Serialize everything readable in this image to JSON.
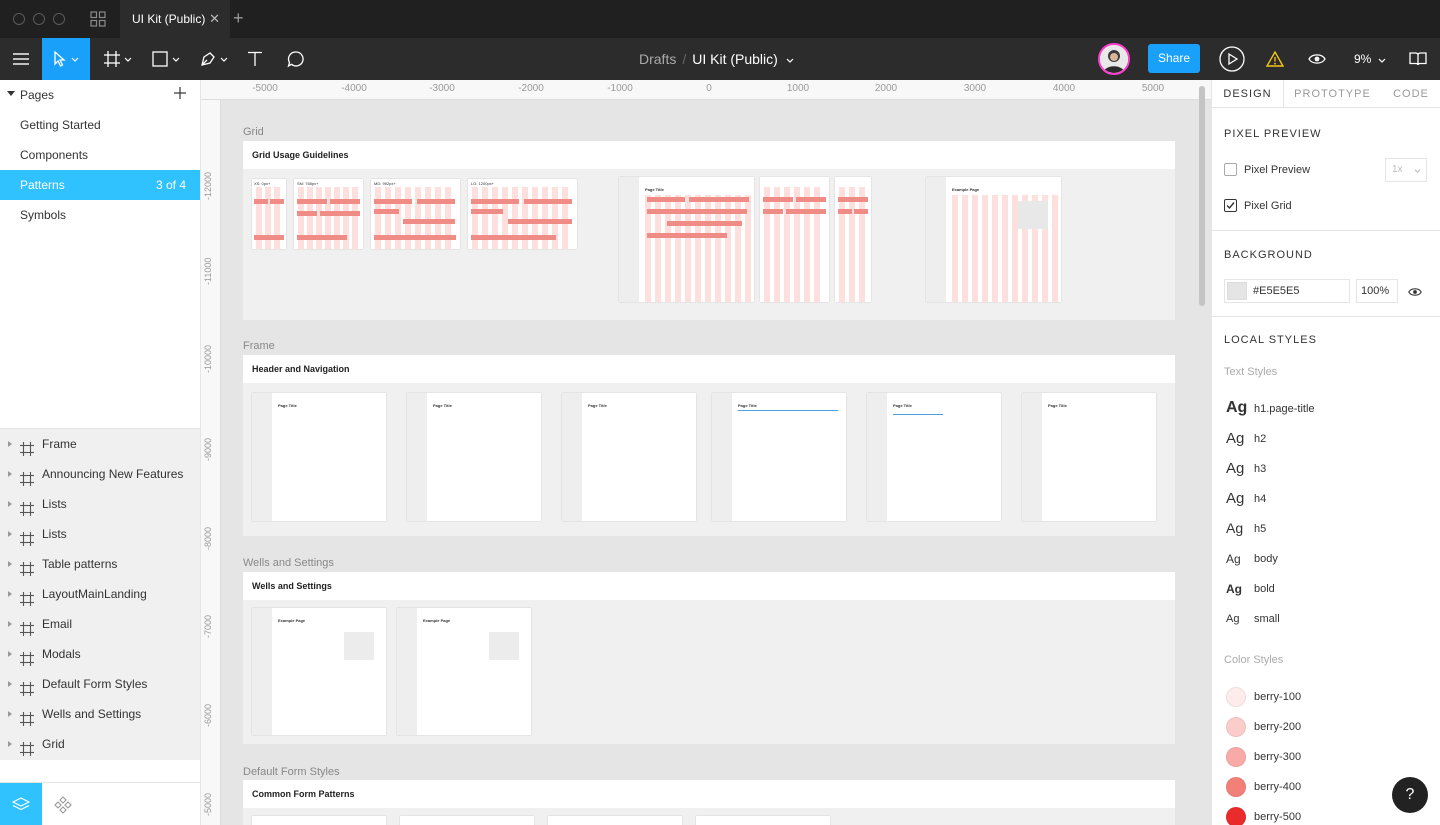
{
  "window": {
    "tab_title": "UI Kit (Public)",
    "tab_close": "✕",
    "tab_add": "+"
  },
  "toolbar": {
    "breadcrumb_parent": "Drafts",
    "breadcrumb_sep": "/",
    "file_name": "UI Kit (Public)",
    "share_label": "Share",
    "zoom_label": "9%"
  },
  "pages": {
    "header": "Pages",
    "items": [
      {
        "label": "Getting Started",
        "count": ""
      },
      {
        "label": "Components",
        "count": ""
      },
      {
        "label": "Patterns",
        "count": "3 of 4"
      },
      {
        "label": "Symbols",
        "count": ""
      }
    ]
  },
  "layers": [
    "Frame",
    "Announcing New Features",
    "Lists",
    "Lists",
    "Table patterns",
    "LayoutMainLanding",
    "Email",
    "Modals",
    "Default Form Styles",
    "Wells and Settings",
    "Grid"
  ],
  "rulers": {
    "top": [
      "-5000",
      "-4000",
      "-3000",
      "-2000",
      "-1000",
      "0",
      "1000",
      "2000",
      "3000",
      "4000",
      "5000"
    ],
    "left": [
      "-12000",
      "-11000",
      "-10000",
      "-9000",
      "-8000",
      "-7000",
      "-6000",
      "-5000"
    ]
  },
  "canvas": {
    "sections": [
      {
        "label": "Grid",
        "bar_title": "Grid Usage Guidelines"
      },
      {
        "label": "Frame",
        "bar_title": "Header and Navigation"
      },
      {
        "label": "Wells and Settings",
        "bar_title": "Wells and Settings"
      },
      {
        "label": "Default Form Styles",
        "bar_title": "Common Form Patterns"
      }
    ],
    "grid_labels": [
      "XS: 0px+",
      "SM: 768px+",
      "MD: 992px+",
      "LG: 1200px+"
    ],
    "page_title": "Page Title",
    "example_page": "Example Page"
  },
  "right": {
    "tabs": [
      "DESIGN",
      "PROTOTYPE",
      "CODE"
    ],
    "pixel_preview_title": "PIXEL PREVIEW",
    "pixel_preview_label": "Pixel Preview",
    "pixel_grid_label": "Pixel Grid",
    "scale_value": "1x",
    "background_title": "BACKGROUND",
    "background_hex": "#E5E5E5",
    "background_opacity": "100%",
    "local_styles_title": "LOCAL STYLES",
    "text_styles_title": "Text Styles",
    "text_styles": [
      {
        "ag": "Ag",
        "name": "h1.page-title"
      },
      {
        "ag": "Ag",
        "name": "h2"
      },
      {
        "ag": "Ag",
        "name": "h3"
      },
      {
        "ag": "Ag",
        "name": "h4"
      },
      {
        "ag": "Ag",
        "name": "h5"
      },
      {
        "ag": "Ag",
        "name": "body"
      },
      {
        "ag": "Ag",
        "name": "bold"
      },
      {
        "ag": "Ag",
        "name": "small"
      }
    ],
    "color_styles_title": "Color Styles",
    "color_styles": [
      {
        "name": "berry-100",
        "color": "#fdeceb"
      },
      {
        "name": "berry-200",
        "color": "#fbcdca"
      },
      {
        "name": "berry-300",
        "color": "#f8aba6"
      },
      {
        "name": "berry-400",
        "color": "#f28078"
      },
      {
        "name": "berry-500",
        "color": "#ea2b2b"
      }
    ],
    "help_label": "?"
  },
  "colors": {
    "accent": "#18a0fb",
    "selected_page": "#30c2ff",
    "avatar_ring": "#ff3dd0",
    "grid_bar": "#f08c86",
    "grid_stripe": "#fde0dd"
  }
}
